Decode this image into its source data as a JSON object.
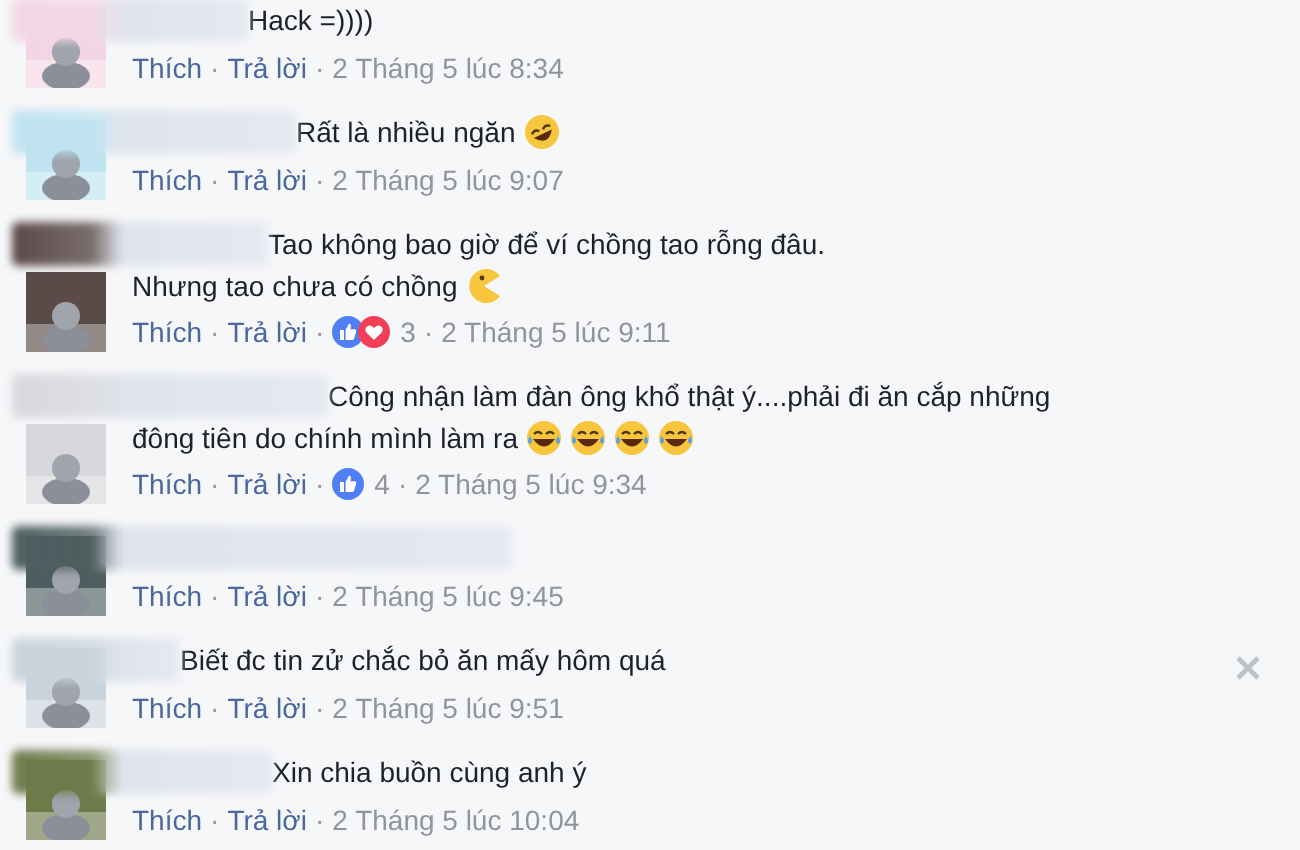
{
  "comments": [
    {
      "lines": [
        "Hack =))))"
      ],
      "like": "Thích",
      "sep_1": "·",
      "reply": "Trả lời",
      "sep_2": "·",
      "time": "2 Tháng 5 lúc 8:34",
      "removable": false
    },
    {
      "lines": [
        "Rất là nhiều ngăn"
      ],
      "emoji": [
        {
          "kind": "rofl"
        }
      ],
      "like": "Thích",
      "sep_1": "·",
      "reply": "Trả lời",
      "sep_2": "·",
      "time": "2 Tháng 5 lúc 9:07",
      "removable": false
    },
    {
      "lines": [
        "Tao không bao giờ để ví chồng tao rỗng đâu.",
        "Nhưng tao chưa có chồng"
      ],
      "emoji": [
        {
          "kind": "pacman"
        }
      ],
      "like": "Thích",
      "sep_1": "·",
      "reply": "Trả lời",
      "sep_2": "·",
      "reactions": [
        {
          "kind": "like"
        },
        {
          "kind": "love"
        }
      ],
      "reaction_count": "3",
      "sep_3": "·",
      "time": "2 Tháng 5 lúc 9:11",
      "removable": false
    },
    {
      "lines": [
        "Công nhận làm đàn ông khổ thật ý....phải đi ăn cắp những",
        "đông tiên do chính mình làm ra"
      ],
      "emoji": [
        {
          "kind": "tears_of_joy"
        },
        {
          "kind": "tears_of_joy"
        },
        {
          "kind": "tears_of_joy"
        },
        {
          "kind": "tears_of_joy"
        }
      ],
      "like": "Thích",
      "sep_1": "·",
      "reply": "Trả lời",
      "sep_2": "·",
      "reactions": [
        {
          "kind": "like"
        }
      ],
      "reaction_count": "4",
      "sep_3": "·",
      "time": "2 Tháng 5 lúc 9:34",
      "removable": false
    },
    {
      "like": "Thích",
      "sep_1": "·",
      "reply": "Trả lời",
      "sep_2": "·",
      "time": "2 Tháng 5 lúc 9:45",
      "removable": false
    },
    {
      "lines": [
        "Biết đc tin zử chắc bỏ ăn mấy hôm quá"
      ],
      "like": "Thích",
      "sep_1": "·",
      "reply": "Trả lời",
      "sep_2": "·",
      "time": "2 Tháng 5 lúc 9:51",
      "removable": true
    },
    {
      "lines": [
        "Xin chia buồn cùng anh ý"
      ],
      "like": "Thích",
      "sep_1": "·",
      "reply": "Trả lời",
      "sep_2": "·",
      "time": "2 Tháng 5 lúc 10:04",
      "removable": false
    }
  ]
}
